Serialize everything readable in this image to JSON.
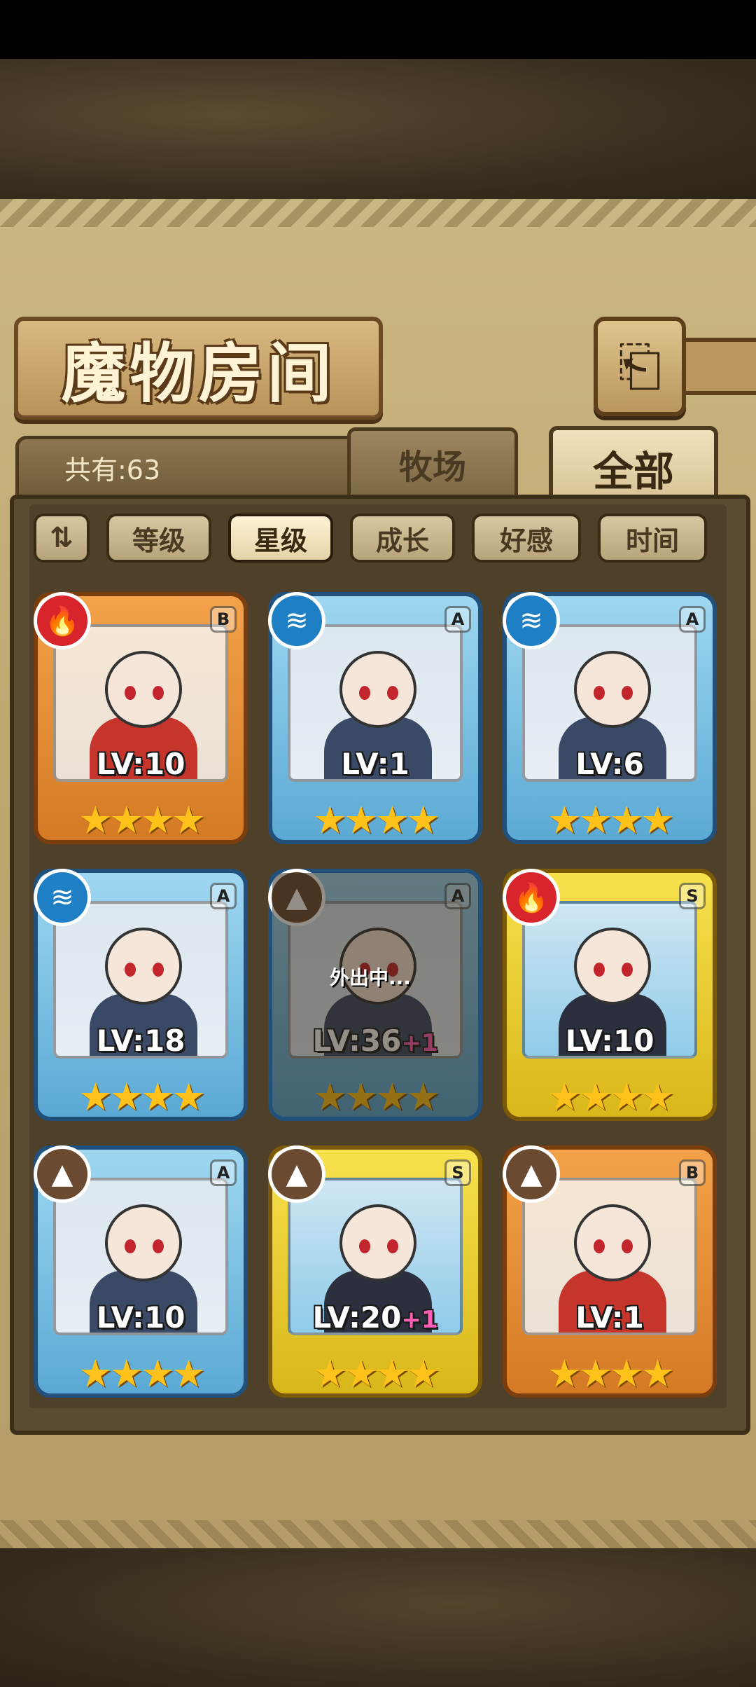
{
  "header": {
    "title": "魔物房间",
    "back_icon": "⎗"
  },
  "tabs": {
    "count_label": "共有:63",
    "farm_label": "牧场",
    "all_label": "全部"
  },
  "filters": {
    "sort_icon": "⇅",
    "level": "等级",
    "star": "星级",
    "growth": "成长",
    "affection": "好感",
    "time": "时间",
    "active": "星级"
  },
  "monsters": [
    {
      "level": "LV:10",
      "bonus": "",
      "rank": "B",
      "element": "fire",
      "element_icon": "🔥",
      "frame": "orange",
      "stars": "★★★★",
      "away_label": ""
    },
    {
      "level": "LV:1",
      "bonus": "",
      "rank": "A",
      "element": "water",
      "element_icon": "≋",
      "frame": "blue",
      "stars": "★★★★",
      "away_label": ""
    },
    {
      "level": "LV:6",
      "bonus": "",
      "rank": "A",
      "element": "water",
      "element_icon": "≋",
      "frame": "blue",
      "stars": "★★★★",
      "away_label": ""
    },
    {
      "level": "LV:18",
      "bonus": "",
      "rank": "A",
      "element": "water",
      "element_icon": "≋",
      "frame": "blue",
      "stars": "★★★★",
      "away_label": ""
    },
    {
      "level": "LV:36",
      "bonus": "+1",
      "rank": "A",
      "element": "earth",
      "element_icon": "▲",
      "frame": "blue",
      "stars": "★★★★",
      "away_label": "外出中..."
    },
    {
      "level": "LV:10",
      "bonus": "",
      "rank": "S",
      "element": "fire",
      "element_icon": "🔥",
      "frame": "gold",
      "stars": "★★★★",
      "away_label": ""
    },
    {
      "level": "LV:10",
      "bonus": "",
      "rank": "A",
      "element": "earth",
      "element_icon": "▲",
      "frame": "blue",
      "stars": "★★★★",
      "away_label": ""
    },
    {
      "level": "LV:20",
      "bonus": "+1",
      "rank": "S",
      "element": "earth",
      "element_icon": "▲",
      "frame": "gold",
      "stars": "★★★★",
      "away_label": ""
    },
    {
      "level": "LV:1",
      "bonus": "",
      "rank": "B",
      "element": "earth",
      "element_icon": "▲",
      "frame": "orange",
      "stars": "★★★★",
      "away_label": ""
    }
  ],
  "colors": {
    "fire": "#d8252b",
    "water": "#1f7fc4",
    "earth": "#6b4a32"
  }
}
